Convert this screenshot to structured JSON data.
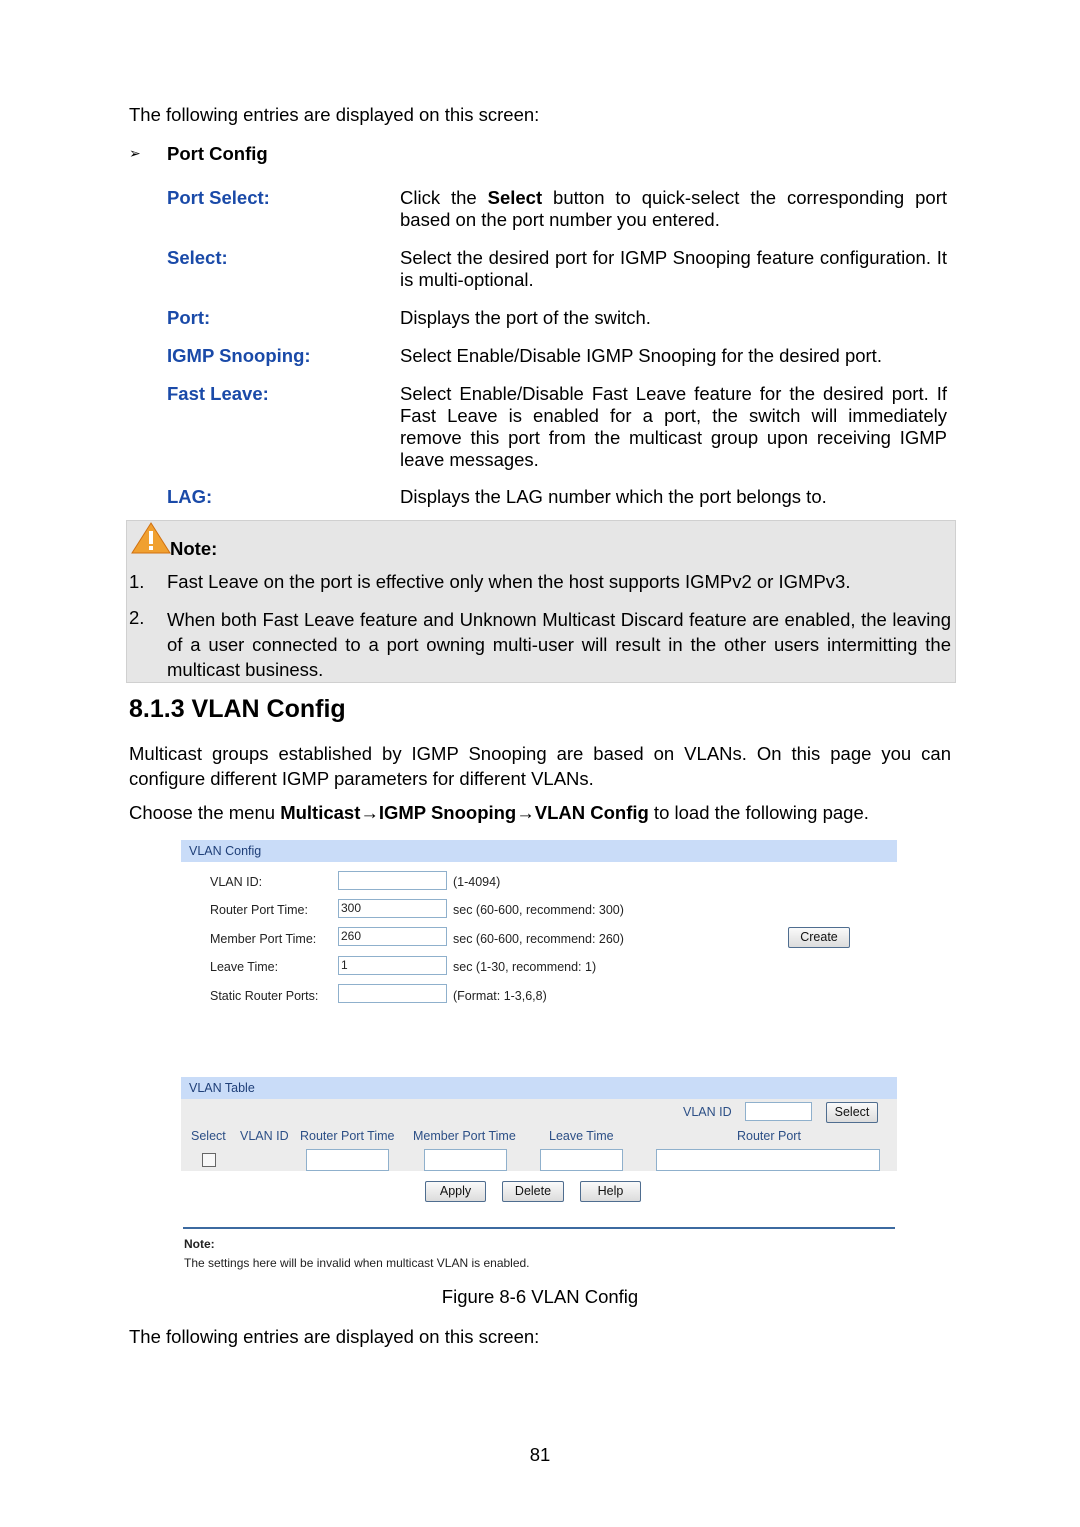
{
  "intro": "The following entries are displayed on this screen:",
  "section": {
    "bullet": "➢",
    "title": "Port Config"
  },
  "entries": [
    {
      "term": "Port Select:",
      "desc_pre": "Click the ",
      "desc_bold": "Select",
      "desc_post": " button to quick-select the corresponding port based on the port number you entered."
    },
    {
      "term": "Select:",
      "desc": "Select the desired port for IGMP Snooping feature configuration. It is multi-optional."
    },
    {
      "term": "Port:",
      "desc": "Displays the port of the switch."
    },
    {
      "term": "IGMP Snooping:",
      "desc": "Select Enable/Disable IGMP Snooping for the desired port."
    },
    {
      "term": "Fast Leave:",
      "desc": "Select Enable/Disable Fast Leave feature for the desired port. If Fast Leave is enabled for a port, the switch will immediately remove this port from the multicast group upon receiving IGMP leave messages."
    },
    {
      "term": "LAG:",
      "desc": "Displays the LAG number which the port belongs to."
    }
  ],
  "note": {
    "title": "Note:",
    "items": [
      {
        "num": "1.",
        "text": "Fast Leave on the port is effective only when the host supports IGMPv2 or IGMPv3."
      },
      {
        "num": "2.",
        "text": "When both Fast Leave feature and Unknown Multicast Discard feature are enabled, the leaving of a user connected to a port owning multi-user will result in the other users intermitting the multicast business."
      }
    ]
  },
  "heading": "8.1.3 VLAN Config",
  "para1": "Multicast groups established by IGMP Snooping are based on VLANs. On this page you can configure different IGMP parameters for different VLANs.",
  "para2": {
    "pre": "Choose the menu ",
    "bold": "Multicast→IGMP Snooping→VLAN Config",
    "post": " to load the following page."
  },
  "figure": {
    "config_title": "VLAN Config",
    "fields": [
      {
        "label": "VLAN ID:",
        "value": "",
        "hint": "(1-4094)"
      },
      {
        "label": "Router Port Time:",
        "value": "300",
        "hint": "sec (60-600, recommend: 300)"
      },
      {
        "label": "Member Port Time:",
        "value": "260",
        "hint": "sec (60-600, recommend: 260)"
      },
      {
        "label": "Leave Time:",
        "value": "1",
        "hint": "sec (1-30, recommend: 1)"
      },
      {
        "label": "Static Router Ports:",
        "value": "",
        "hint": "(Format: 1-3,6,8)"
      }
    ],
    "create": "Create",
    "table_title": "VLAN Table",
    "search_label": "VLAN ID",
    "search_value": "",
    "select_btn": "Select",
    "columns": [
      "Select",
      "VLAN ID",
      "Router Port Time",
      "Member Port Time",
      "Leave Time",
      "Router Port"
    ],
    "apply": "Apply",
    "delete": "Delete",
    "help": "Help",
    "note_title": "Note:",
    "note_text": "The settings here will be invalid when multicast VLAN is enabled."
  },
  "caption": "Figure 8-6 VLAN Config",
  "outro": "The following entries are displayed on this screen:",
  "page_number": "81",
  "colors": {
    "term": "#1a4aa8",
    "bar": "#c9dcf8",
    "note_bg": "#e6e6e6"
  }
}
